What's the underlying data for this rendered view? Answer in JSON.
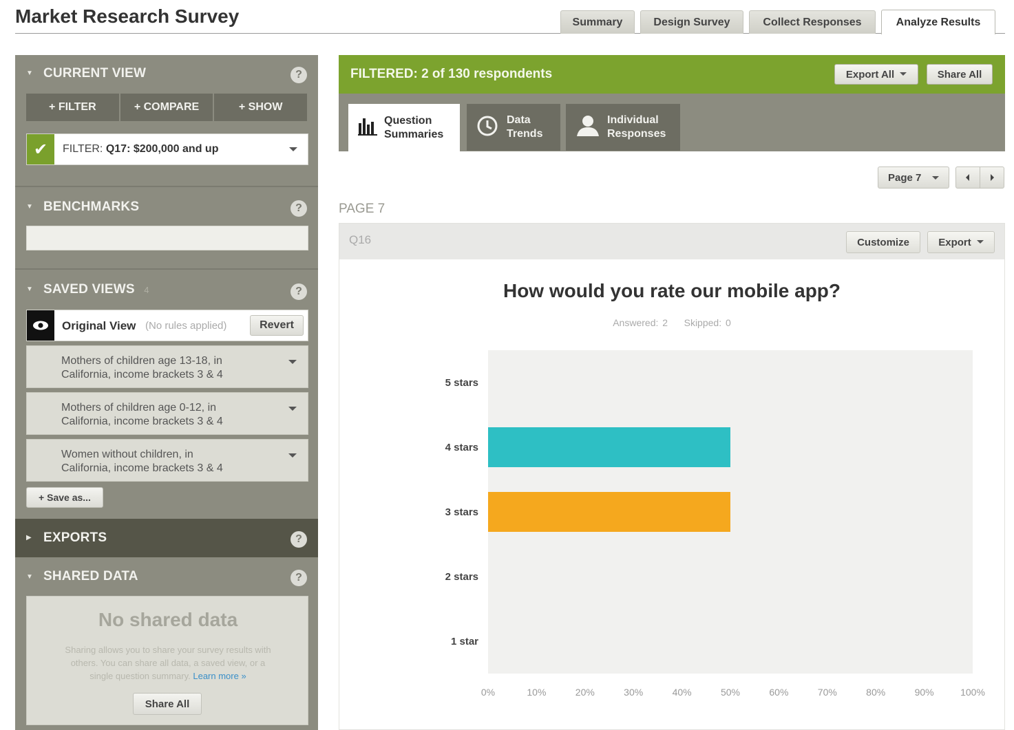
{
  "app": {
    "title": "Market Research Survey",
    "tabs": [
      {
        "label": "Summary",
        "active": false
      },
      {
        "label": "Design Survey",
        "active": false
      },
      {
        "label": "Collect Responses",
        "active": false
      },
      {
        "label": "Analyze Results",
        "active": true
      }
    ]
  },
  "sidebar": {
    "current_view": {
      "title": "CURRENT VIEW",
      "buttons": [
        "+ FILTER",
        "+ COMPARE",
        "+ SHOW"
      ],
      "filter": {
        "prefix": "FILTER:",
        "value": "Q17: $200,000 and up",
        "active": true
      }
    },
    "benchmarks": {
      "title": "BENCHMARKS"
    },
    "saved_views": {
      "title": "SAVED VIEWS",
      "count": "4",
      "original": {
        "label": "Original View",
        "note": "(No rules applied)",
        "revert_label": "Revert"
      },
      "items": [
        {
          "line1": "Mothers of children age 13-18, in",
          "line2": "California, income brackets 3 & 4"
        },
        {
          "line1": "Mothers of children age 0-12, in",
          "line2": "California, income brackets 3 & 4"
        },
        {
          "line1": "Women without children, in",
          "line2": "California, income brackets 3 & 4"
        }
      ],
      "save_as_label": "+ Save as..."
    },
    "exports": {
      "title": "EXPORTS"
    },
    "shared_data": {
      "title": "SHARED DATA",
      "empty_title": "No shared data",
      "description_line1": "Sharing allows you to share your survey results with",
      "description_line2": "others. You can share all data, a saved view, or a",
      "description_line3": "single question summary.",
      "learn_more": "Learn more »",
      "share_all_label": "Share All"
    }
  },
  "main": {
    "filter_banner": "FILTERED: 2 of 130 respondents",
    "export_all_label": "Export All",
    "share_all_label": "Share All",
    "view_tabs": [
      {
        "line1": "Question",
        "line2": "Summaries",
        "icon": "bar-chart-icon",
        "active": true
      },
      {
        "line1": "Data",
        "line2": "Trends",
        "icon": "clock-icon",
        "active": false
      },
      {
        "line1": "Individual",
        "line2": "Responses",
        "icon": "person-icon",
        "active": false
      }
    ],
    "page_selector": "Page 7",
    "page_label": "PAGE 7",
    "question": {
      "id": "Q16",
      "customize_label": "Customize",
      "export_label": "Export",
      "title": "How would you rate our mobile app?",
      "answered": "Answered: 2",
      "skipped": "Skipped: 0"
    }
  },
  "colors": {
    "accent_green": "#7ca32e",
    "sidebar_bg": "#8c8c80",
    "bar_teal": "#2ebfc4",
    "bar_orange": "#f5a81e"
  },
  "chart_data": {
    "type": "bar",
    "orientation": "horizontal",
    "categories": [
      "5 stars",
      "4 stars",
      "3 stars",
      "2 stars",
      "1 star"
    ],
    "values": [
      0,
      50,
      50,
      0,
      0
    ],
    "bar_colors": [
      "#2ebfc4",
      "#2ebfc4",
      "#f5a81e",
      "#2ebfc4",
      "#2ebfc4"
    ],
    "x_ticks": [
      "0%",
      "10%",
      "20%",
      "30%",
      "40%",
      "50%",
      "60%",
      "70%",
      "80%",
      "90%",
      "100%"
    ],
    "xlim": [
      0,
      100
    ],
    "title": "How would you rate our mobile app?",
    "grid": false
  }
}
